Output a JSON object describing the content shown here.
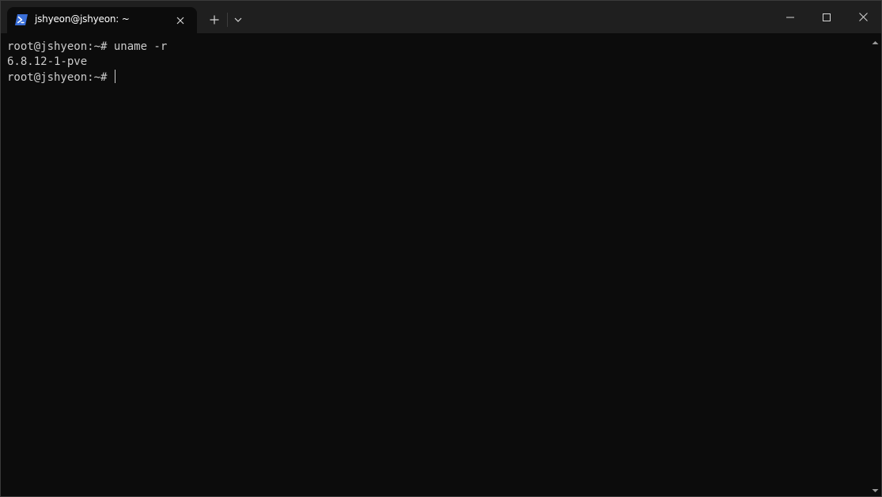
{
  "window": {
    "colors": {
      "titlebar": "#1f1f1f",
      "terminal_background": "#0c0c0c",
      "terminal_text": "#cccccc",
      "tab_icon_accent": "#3a6fd8"
    }
  },
  "tabs": [
    {
      "title": "jshyeon@jshyeon: ~",
      "icon": "powershell-icon",
      "active": true
    }
  ],
  "titlebar_controls": {
    "new_tab_icon": "plus-icon",
    "dropdown_icon": "chevron-down-icon",
    "minimize_icon": "minimize-icon",
    "maximize_icon": "maximize-icon",
    "close_icon": "close-icon"
  },
  "terminal": {
    "lines": [
      {
        "prompt": "root@jshyeon:~# ",
        "command": "uname -r"
      },
      {
        "output": "6.8.12-1-pve"
      },
      {
        "prompt": "root@jshyeon:~# ",
        "command": ""
      }
    ]
  }
}
